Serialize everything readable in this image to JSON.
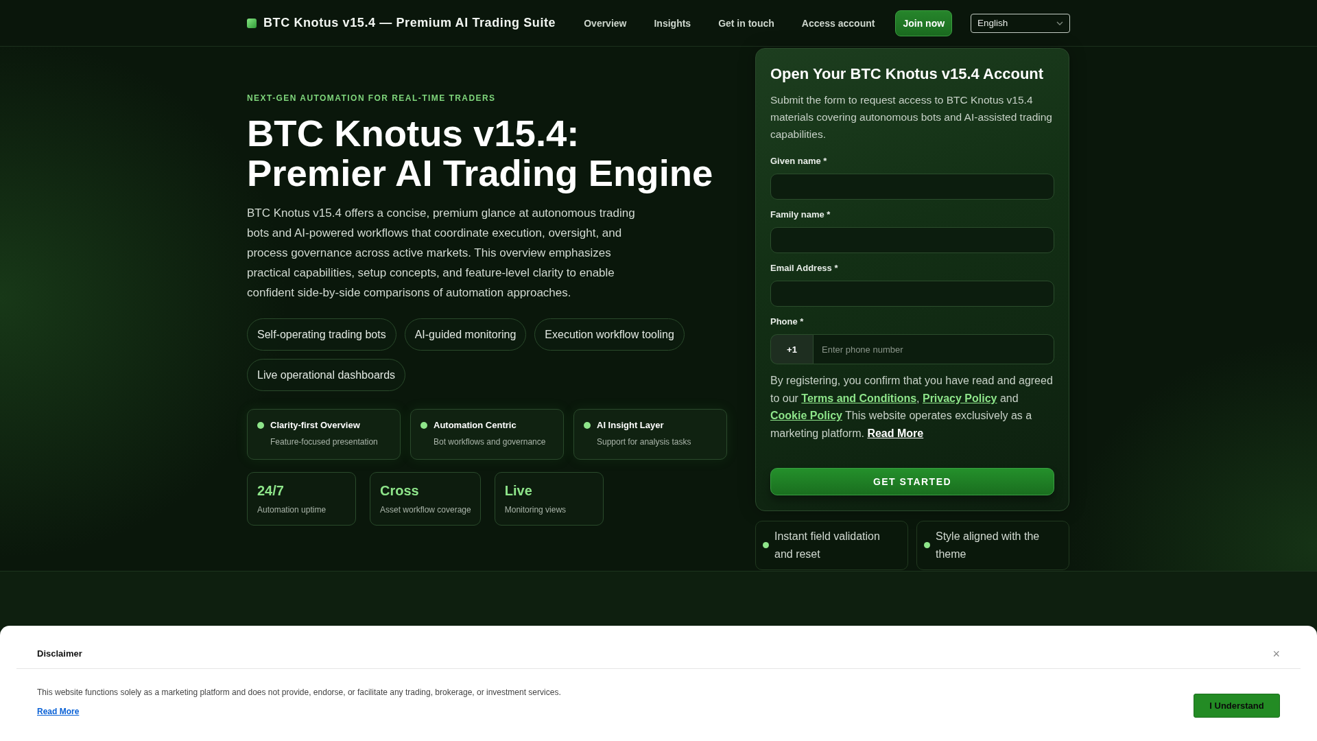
{
  "header": {
    "brand": "BTC Knotus v15.4 — Premium AI Trading Suite",
    "nav": [
      {
        "label": "Overview"
      },
      {
        "label": "Insights"
      },
      {
        "label": "Get in touch"
      },
      {
        "label": "Access account"
      }
    ],
    "join_button": "Join now",
    "language": {
      "value": "English"
    }
  },
  "hero": {
    "eyebrow": "NEXT-GEN AUTOMATION FOR REAL-TIME TRADERS",
    "title": "BTC Knotus v15.4: Premier AI Trading Engine",
    "description": "BTC Knotus v15.4 offers a concise, premium glance at autonomous trading bots and AI-powered workflows that coordinate execution, oversight, and process governance across active markets. This overview emphasizes practical capabilities, setup concepts, and feature-level clarity to enable confident side-by-side comparisons of automation approaches.",
    "tags": [
      "Self-operating trading bots",
      "AI-guided monitoring",
      "Execution workflow tooling",
      "Live operational dashboards"
    ],
    "features": [
      {
        "title": "Clarity-first Overview",
        "subtitle": "Feature-focused presentation"
      },
      {
        "title": "Automation Centric",
        "subtitle": "Bot workflows and governance"
      },
      {
        "title": "AI Insight Layer",
        "subtitle": "Support for analysis tasks"
      }
    ],
    "stats": [
      {
        "value": "24/7",
        "label": "Automation uptime"
      },
      {
        "value": "Cross",
        "label": "Asset workflow coverage"
      },
      {
        "value": "Live",
        "label": "Monitoring views"
      }
    ]
  },
  "signup_form": {
    "title": "Open Your BTC Knotus v15.4 Account",
    "description": "Submit the form to request access to BTC Knotus v15.4 materials covering autonomous bots and AI-assisted trading capabilities.",
    "fields": [
      {
        "kind": "text",
        "label": "Given name *"
      },
      {
        "kind": "text",
        "label": "Family name *"
      },
      {
        "kind": "text",
        "label": "Email Address *"
      },
      {
        "kind": "phone",
        "label": "Phone *",
        "prefix": "+1",
        "placeholder": "Enter phone number"
      }
    ],
    "consent": [
      {
        "kind": "text",
        "text": "By registering, you confirm that you have read and agreed to our "
      },
      {
        "kind": "link",
        "text": "Terms and Conditions"
      },
      {
        "kind": "text",
        "text": ", "
      },
      {
        "kind": "link",
        "text": "Privacy Policy"
      },
      {
        "kind": "text",
        "text": " and "
      },
      {
        "kind": "link",
        "text": "Cookie Policy"
      },
      {
        "kind": "text",
        "text": " This website operates exclusively as a marketing platform. "
      },
      {
        "kind": "more_link",
        "text": "Read More"
      }
    ],
    "submit": "GET STARTED"
  },
  "highlights": [
    {
      "text": "Instant field validation and reset"
    },
    {
      "text": "Style aligned with the theme"
    }
  ],
  "disclaimer": {
    "title": "Disclaimer",
    "close": "×",
    "body": "This website functions solely as a marketing platform and does not provide, endorse, or facilitate any trading, brokerage, or investment services.",
    "link": "Read More",
    "button": "I Understand"
  }
}
